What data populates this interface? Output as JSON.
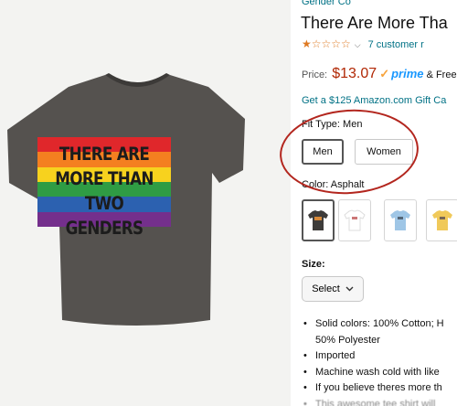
{
  "product_image": {
    "shirt_text_lines": [
      "THERE ARE",
      "MORE THAN",
      "TWO GENDERS"
    ],
    "shirt_color": "#55524f",
    "flag_colors": [
      "#e0272b",
      "#f47f20",
      "#f7d21e",
      "#2f9c44",
      "#2c61b0",
      "#742f8c"
    ]
  },
  "detail": {
    "brand": "Gender Co",
    "title": "There Are More Tha",
    "rating": {
      "stars": "★☆☆☆☆",
      "count_text": "7 customer r"
    },
    "price": {
      "label": "Price:",
      "value": "$13.07",
      "prime_check": "✓",
      "prime": "prime",
      "free_text": "& Free"
    },
    "gift_link": "Get a $125 Amazon.com Gift Ca",
    "fit_type": {
      "label": "Fit Type:",
      "value": "Men",
      "options": [
        "Men",
        "Women"
      ]
    },
    "color": {
      "label": "Color:",
      "value": "Asphalt",
      "swatches": [
        "#3e3c3a",
        "#ffffff",
        "#9fc6e6",
        "#f0c95a"
      ]
    },
    "size": {
      "label": "Size:",
      "select_value": "Select"
    },
    "bullets": [
      "Solid colors: 100% Cotton; H",
      "50% Polyester",
      "Imported",
      "Machine wash cold with like",
      "If you believe theres more th",
      "This awesome tee shirt will"
    ]
  }
}
